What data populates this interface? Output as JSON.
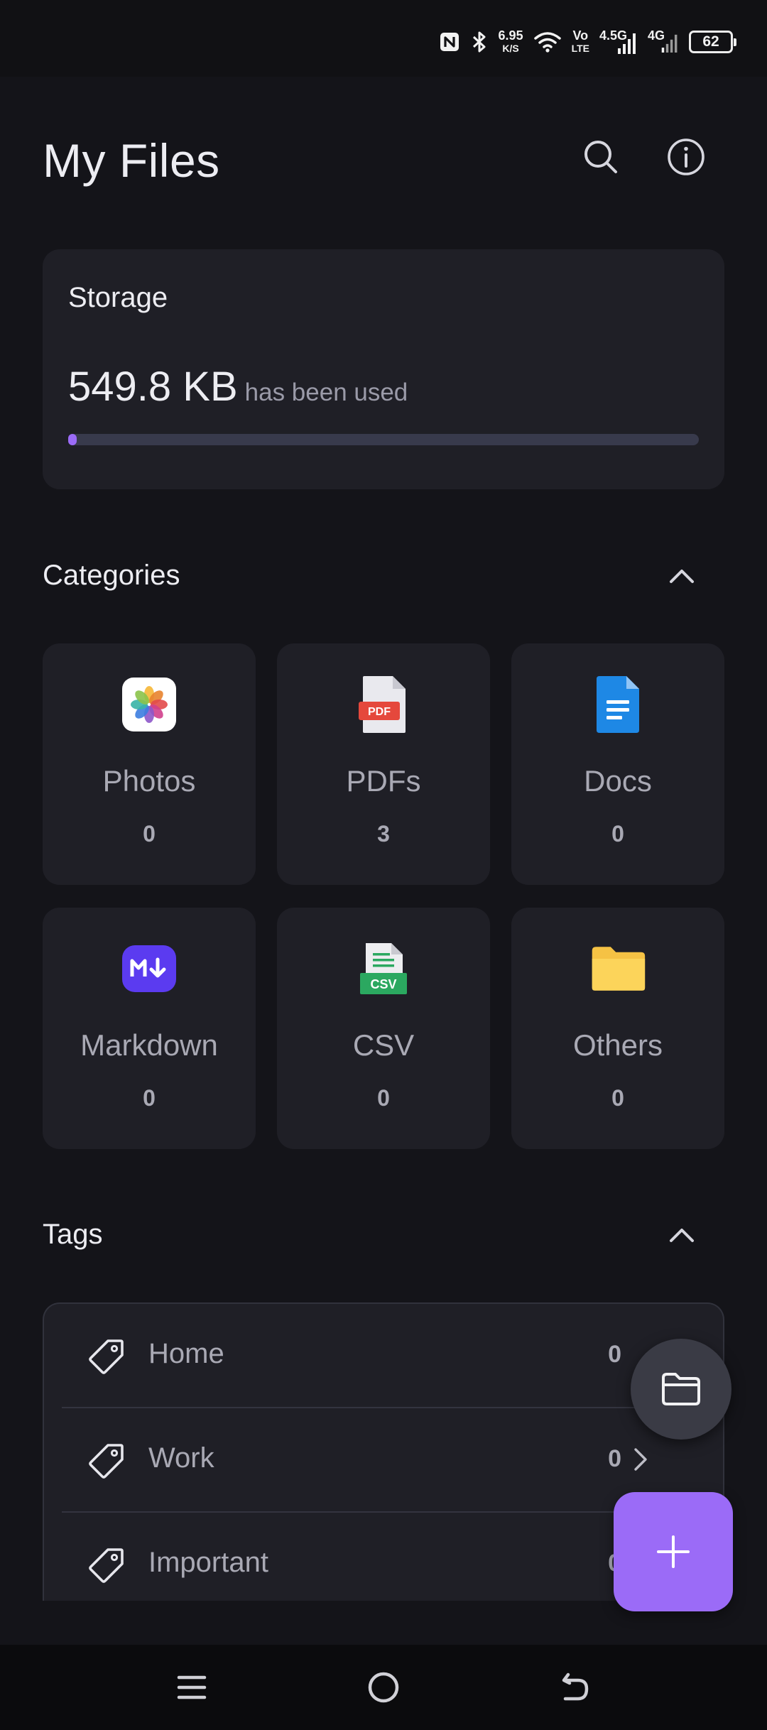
{
  "status_bar": {
    "nfc_icon": "nfc-icon",
    "bluetooth_icon": "bluetooth-icon",
    "speed_value": "6.95",
    "speed_unit": "K/S",
    "volte_top": "Vo",
    "volte_bottom": "LTE",
    "net1_label": "4.5G",
    "net2_label": "4G",
    "battery_level": "62"
  },
  "header": {
    "title": "My Files",
    "search_icon": "search-icon",
    "info_icon": "info-icon"
  },
  "storage": {
    "label": "Storage",
    "used_value": "549.8 KB",
    "used_suffix": "has been used",
    "progress_fraction": 0.01,
    "accent_color": "#9B6BF7"
  },
  "categories": {
    "title": "Categories",
    "collapse_icon": "chevron-up-icon",
    "items": [
      {
        "name": "Photos",
        "count": "0",
        "icon": "photos-icon"
      },
      {
        "name": "PDFs",
        "count": "3",
        "icon": "pdf-icon"
      },
      {
        "name": "Docs",
        "count": "0",
        "icon": "docs-icon"
      },
      {
        "name": "Markdown",
        "count": "0",
        "icon": "markdown-icon"
      },
      {
        "name": "CSV",
        "count": "0",
        "icon": "csv-icon"
      },
      {
        "name": "Others",
        "count": "0",
        "icon": "folder-icon"
      }
    ]
  },
  "tags": {
    "title": "Tags",
    "collapse_icon": "chevron-up-icon",
    "items": [
      {
        "label": "Home",
        "count": "0"
      },
      {
        "label": "Work",
        "count": "0"
      },
      {
        "label": "Important",
        "count": "0"
      }
    ]
  },
  "fab": {
    "folder_icon": "folder-open-icon",
    "add_icon": "plus-icon",
    "add_color": "#9B6BF7"
  },
  "nav_bar": {
    "menu_icon": "menu-icon",
    "home_icon": "home-circle-icon",
    "back_icon": "back-icon"
  }
}
